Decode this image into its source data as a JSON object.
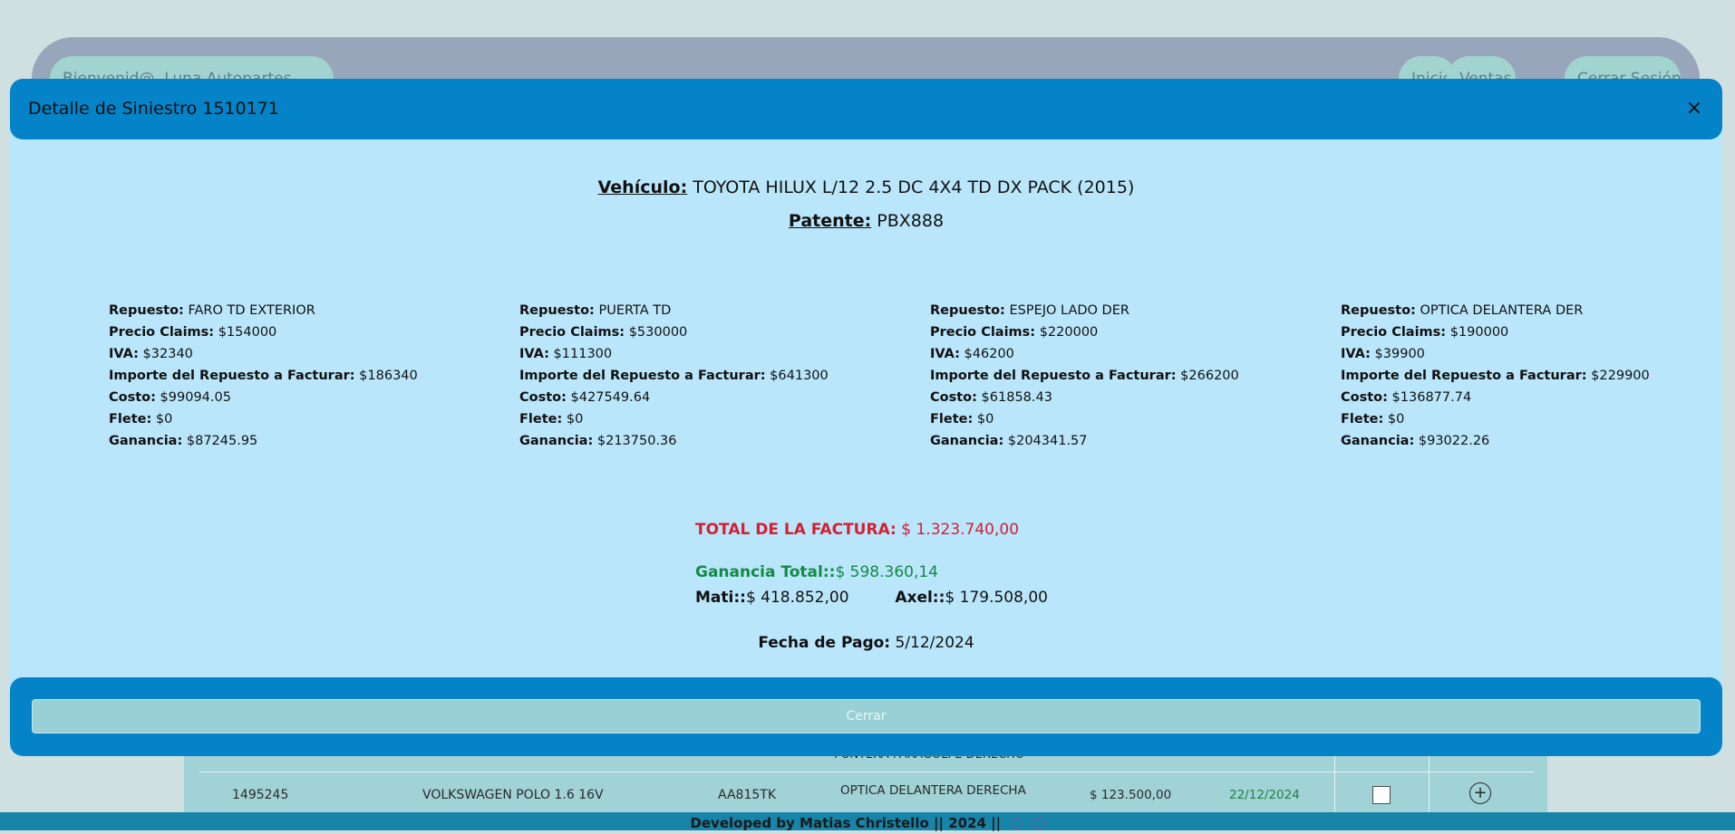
{
  "navbar": {
    "welcome": "Bienvenid@, Luna Autopartes",
    "links": [
      "Inicio",
      "Ventas",
      "Cerrar Sesión"
    ]
  },
  "table": {
    "partial_row_text": "PUNTERA PARAGOLPE DERECHO",
    "row": {
      "id": "1495245",
      "vehicle": "VOLKSWAGEN POLO 1.6 16V",
      "plate": "AA815TK",
      "part": "OPTICA DELANTERA DERECHA",
      "amount": "$ 123.500,00",
      "date": "22/12/2024",
      "plus": "+"
    }
  },
  "footer": {
    "text": "Developed by Matias Christello || 2024 ||"
  },
  "modal": {
    "title": "Detalle de Siniestro 1510171",
    "close_icon": "×",
    "vehicle_label": "Vehículo:",
    "vehicle_value": "TOYOTA HILUX L/12 2.5 DC 4X4 TD DX PACK (2015)",
    "plate_label": "Patente:",
    "plate_value": "PBX888",
    "labels": {
      "part": "Repuesto:",
      "claims": "Precio Claims:",
      "iva": "IVA:",
      "invoice": "Importe del Repuesto a Facturar:",
      "cost": "Costo:",
      "freight": "Flete:",
      "profit": "Ganancia:"
    },
    "parts": [
      {
        "part": "FARO TD EXTERIOR",
        "claims": "$154000",
        "iva": "$32340",
        "invoice": "$186340",
        "cost": "$99094.05",
        "freight": "$0",
        "profit": "$87245.95"
      },
      {
        "part": "PUERTA TD",
        "claims": "$530000",
        "iva": "$111300",
        "invoice": "$641300",
        "cost": "$427549.64",
        "freight": "$0",
        "profit": "$213750.36"
      },
      {
        "part": "ESPEJO LADO DER",
        "claims": "$220000",
        "iva": "$46200",
        "invoice": "$266200",
        "cost": "$61858.43",
        "freight": "$0",
        "profit": "$204341.57"
      },
      {
        "part": "OPTICA DELANTERA DER",
        "claims": "$190000",
        "iva": "$39900",
        "invoice": "$229900",
        "cost": "$136877.74",
        "freight": "$0",
        "profit": "$93022.26"
      }
    ],
    "total_label": "TOTAL DE LA FACTURA:",
    "total_value": "$ 1.323.740,00",
    "gain_label": "Ganancia Total::",
    "gain_value": "$ 598.360,14",
    "mati_label": "Mati::",
    "mati_value": "$ 418.852,00",
    "axel_label": "Axel::",
    "axel_value": "$ 179.508,00",
    "pay_label": "Fecha de Pago:",
    "pay_value": "5/12/2024",
    "close_button": "Cerrar"
  },
  "colors": {
    "header": "#0483c8",
    "body": "#bae6fb",
    "total": "#d42033",
    "gain": "#138a43"
  }
}
